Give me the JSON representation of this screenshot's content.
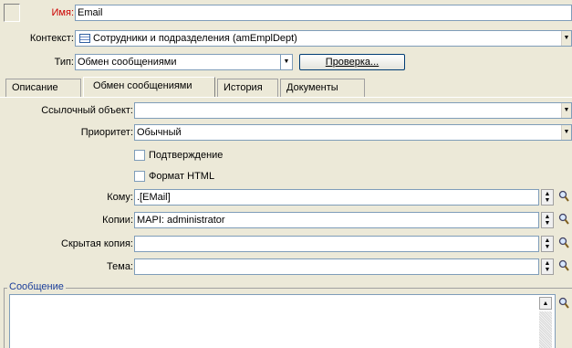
{
  "header": {
    "name_label": "Имя:",
    "name_value": "Email",
    "context_label": "Контекст:",
    "context_value": "Сотрудники и подразделения (amEmplDept)",
    "type_label": "Тип:",
    "type_value": "Обмен сообщениями",
    "check_button": "Проверка..."
  },
  "tabs": [
    {
      "label": "Описание"
    },
    {
      "label": "Обмен сообщениями"
    },
    {
      "label": "История"
    },
    {
      "label": "Документы"
    }
  ],
  "form": {
    "ref_object_label": "Ссылочный объект:",
    "ref_object_value": "",
    "priority_label": "Приоритет:",
    "priority_value": "Обычный",
    "confirm_label": "Подтверждение",
    "html_label": "Формат HTML",
    "to_label": "Кому:",
    "to_value": ".[EMail]",
    "cc_label": "Копии:",
    "cc_value": "MAPI: administrator",
    "bcc_label": "Скрытая копия:",
    "bcc_value": "",
    "subject_label": "Тема:",
    "subject_value": "",
    "message_label": "Сообщение"
  },
  "colors": {
    "accent_red": "#cc0000",
    "message_blue": "#1a3d9a"
  }
}
